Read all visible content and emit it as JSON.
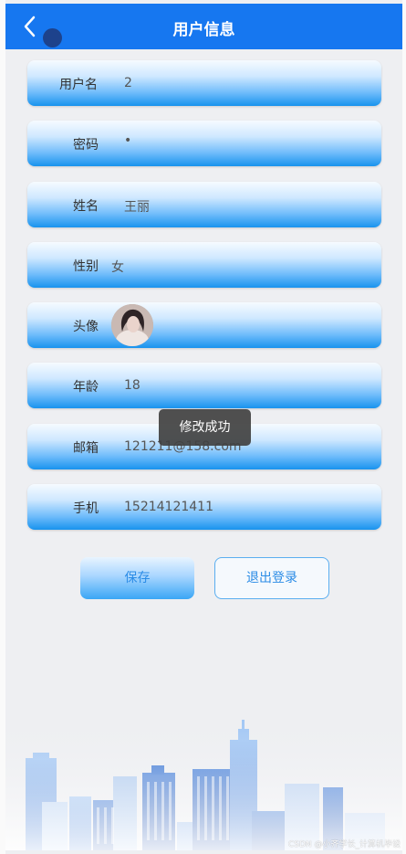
{
  "header": {
    "title": "用户信息"
  },
  "fields": [
    {
      "label": "用户名",
      "value": "2"
    },
    {
      "label": "密码",
      "value": "•"
    },
    {
      "label": "姓名",
      "value": "王丽"
    },
    {
      "label": "性别",
      "value": "女"
    },
    {
      "label": "头像",
      "value": ""
    },
    {
      "label": "年龄",
      "value": "18"
    },
    {
      "label": "邮箱",
      "value": "121211@158.com"
    },
    {
      "label": "手机",
      "value": "15214121411"
    }
  ],
  "toast": {
    "text": "修改成功"
  },
  "buttons": {
    "save": "保存",
    "logout": "退出登录"
  },
  "watermark": "CSDN @小齐学长_计算机毕设",
  "colors": {
    "header": "#1677f0",
    "accent": "#2b8ce6"
  }
}
